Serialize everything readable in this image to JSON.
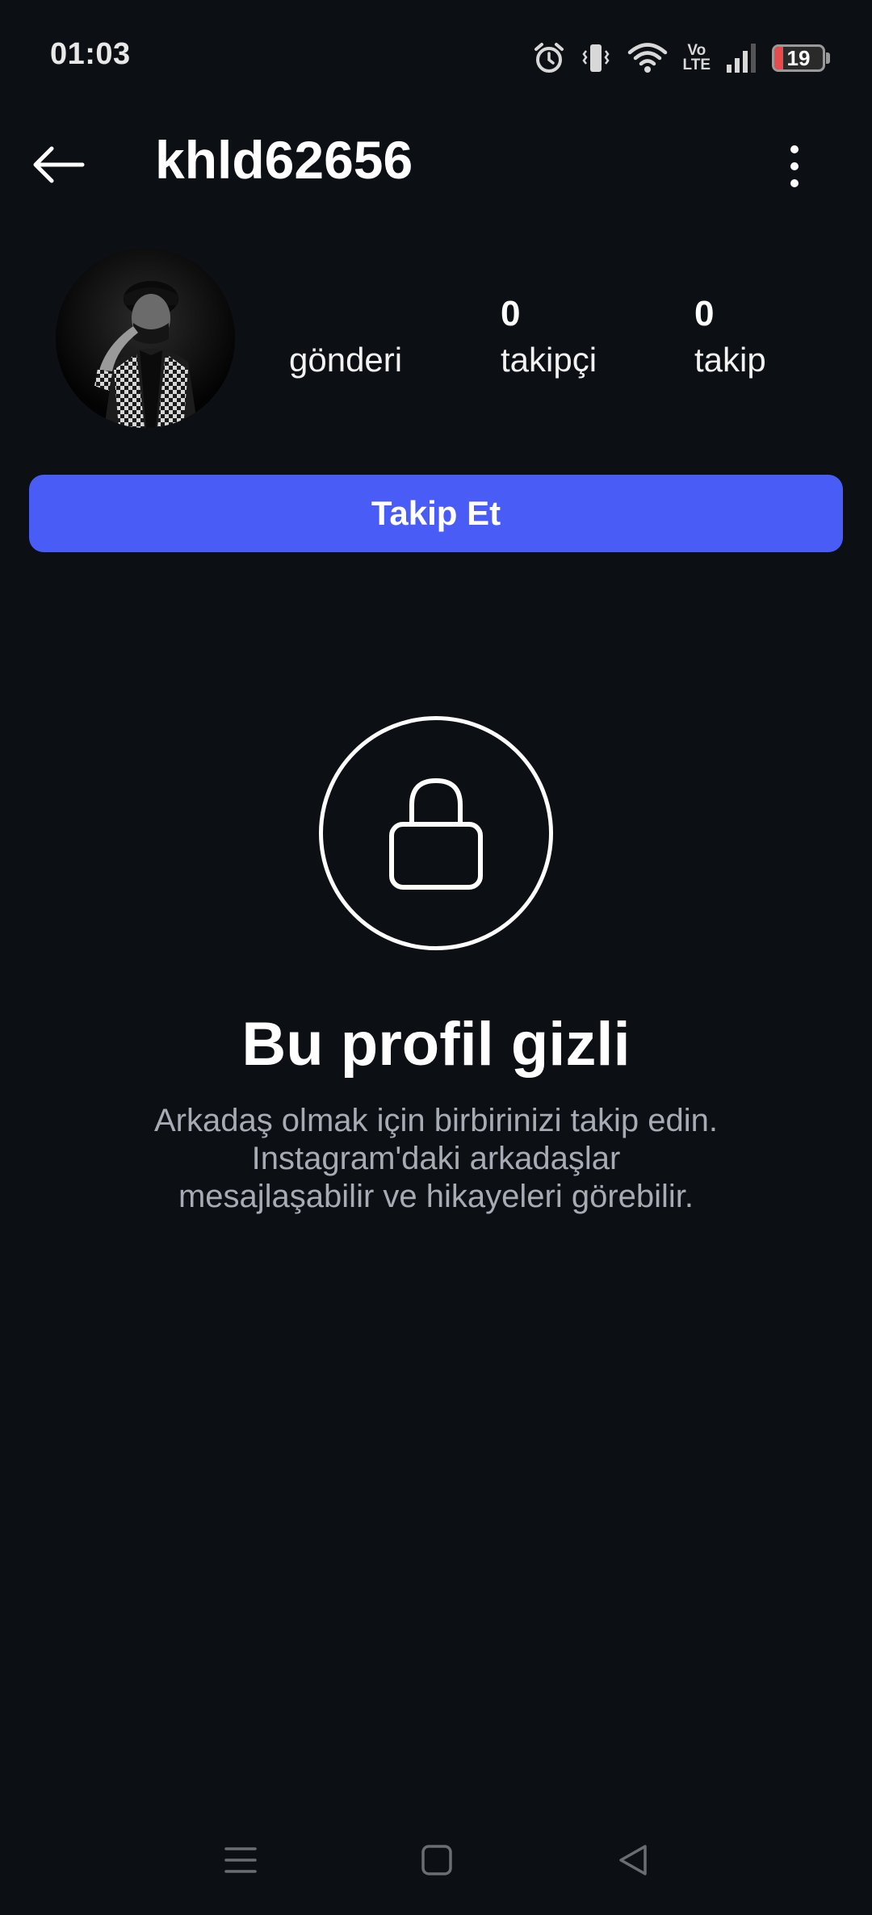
{
  "status_bar": {
    "time": "01:03",
    "battery": "19",
    "battery_level": 0.19,
    "network_label_top": "Vo",
    "network_label_bottom": "LTE",
    "icons": [
      "alarm-icon",
      "vibrate-icon",
      "wifi-icon",
      "volte-icon",
      "signal-icon",
      "battery-icon"
    ]
  },
  "header": {
    "username": "khld62656",
    "back_icon": "arrow-left-icon",
    "menu_icon": "more-vertical-icon"
  },
  "profile": {
    "stats": [
      {
        "value": "",
        "label": "gönderi"
      },
      {
        "value": "0",
        "label": "takipçi"
      },
      {
        "value": "0",
        "label": "takip"
      }
    ],
    "follow_label": "Takip Et"
  },
  "private": {
    "icon": "lock-icon",
    "title": "Bu profil gizli",
    "description": "Arkadaş olmak için birbirinizi takip edin. Instagram'daki arkadaşlar mesajlaşabilir ve hikayeleri görebilir."
  },
  "nav": {
    "icons": [
      "menu-icon",
      "home-square-icon",
      "back-triangle-icon"
    ]
  },
  "colors": {
    "background": "#0c0f14",
    "accent": "#4a5cf6",
    "muted_text": "#a7abb3"
  }
}
